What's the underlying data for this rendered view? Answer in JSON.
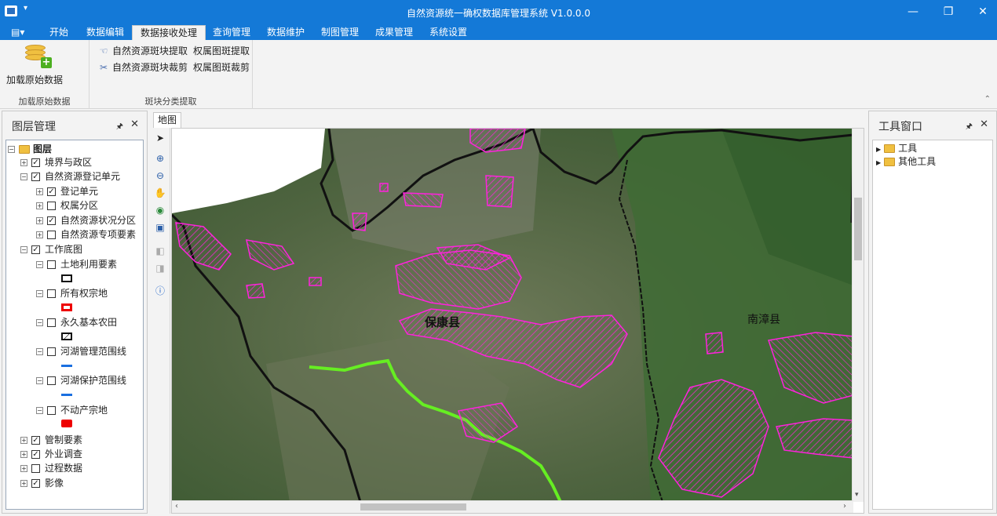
{
  "window": {
    "title": "自然资源统一确权数据库管理系统 V1.0.0.0",
    "quick_access": "▾",
    "min": "—",
    "restore": "❐",
    "close": "✕"
  },
  "menu": {
    "file_glyph": "▤▾",
    "tabs": [
      {
        "label": "开始"
      },
      {
        "label": "数据编辑"
      },
      {
        "label": "数据接收处理"
      },
      {
        "label": "查询管理"
      },
      {
        "label": "数据维护"
      },
      {
        "label": "制图管理"
      },
      {
        "label": "成果管理"
      },
      {
        "label": "系统设置"
      }
    ],
    "active_index": 2
  },
  "ribbon": {
    "groups": [
      {
        "label": "加载原始数据",
        "big_button": "加载原始数据"
      },
      {
        "label": "斑块分类提取",
        "buttons": [
          "自然资源斑块提取",
          "权属图斑提取",
          "自然资源斑块裁剪",
          "权属图斑裁剪"
        ]
      }
    ],
    "collapse_glyph": "⌃"
  },
  "layer_panel": {
    "title": "图层管理",
    "pin": "🖈",
    "close": "✕",
    "nodes": [
      {
        "label": "图层",
        "level": 0,
        "expander": "⊟",
        "checked": null,
        "folder": true
      },
      {
        "label": "境界与政区",
        "level": 1,
        "expander": "+",
        "checked": true
      },
      {
        "label": "自然资源登记单元",
        "level": 1,
        "expander": "−",
        "checked": true
      },
      {
        "label": "登记单元",
        "level": 2,
        "expander": "+",
        "checked": true
      },
      {
        "label": "权属分区",
        "level": 2,
        "expander": "+",
        "checked": false
      },
      {
        "label": "自然资源状况分区",
        "level": 2,
        "expander": "+",
        "checked": true
      },
      {
        "label": "自然资源专项要素",
        "level": 2,
        "expander": "+",
        "checked": false
      },
      {
        "label": "工作底图",
        "level": 1,
        "expander": "−",
        "checked": true
      },
      {
        "label": "土地利用要素",
        "level": 2,
        "expander": "−",
        "checked": false
      },
      {
        "label": "所有权宗地",
        "level": 2,
        "expander": "−",
        "checked": false
      },
      {
        "label": "永久基本农田",
        "level": 2,
        "expander": "−",
        "checked": false
      },
      {
        "label": "河湖管理范围线",
        "level": 2,
        "expander": "−",
        "checked": false
      },
      {
        "label": "河湖保护范围线",
        "level": 2,
        "expander": "−",
        "checked": false
      },
      {
        "label": "不动产宗地",
        "level": 2,
        "expander": "−",
        "checked": false
      },
      {
        "label": "管制要素",
        "level": 1,
        "expander": "+",
        "checked": true
      },
      {
        "label": "外业调查",
        "level": 1,
        "expander": "+",
        "checked": true
      },
      {
        "label": "过程数据",
        "level": 1,
        "expander": "+",
        "checked": false
      },
      {
        "label": "影像",
        "level": 1,
        "expander": "+",
        "checked": true
      }
    ]
  },
  "map": {
    "tab": "地图",
    "labels": [
      "保康县",
      "南漳县"
    ],
    "colors": {
      "parcel": "#ff22dd",
      "river": "#66ee22",
      "boundary": "#111111"
    }
  },
  "tool_panel": {
    "title": "工具窗口",
    "pin": "🖈",
    "close": "✕",
    "nodes": [
      {
        "label": "工具"
      },
      {
        "label": "其他工具"
      }
    ]
  }
}
